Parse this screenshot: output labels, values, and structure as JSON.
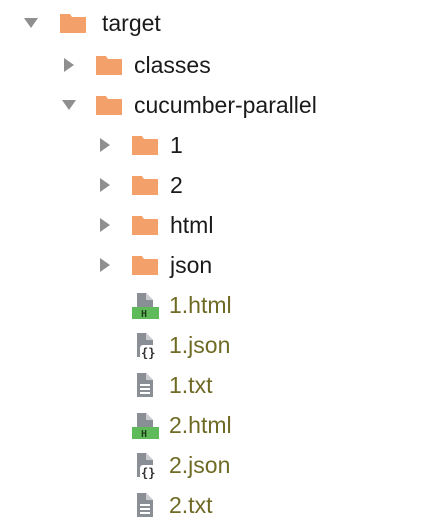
{
  "colors": {
    "folder": "#f4a06a",
    "arrow": "#8f8f8f",
    "file_text": "#6f6a24",
    "folder_text": "#1a1a1a",
    "html_badge": "#5fba5a",
    "doc_gray": "#8a8f96"
  },
  "tree": {
    "root": {
      "label": "target",
      "state": "expanded",
      "icon": "folder-icon"
    },
    "classes": {
      "label": "classes",
      "state": "collapsed",
      "icon": "folder-icon"
    },
    "cucumber": {
      "label": "cucumber-parallel",
      "state": "expanded",
      "icon": "folder-icon"
    },
    "children": [
      {
        "label": "1",
        "state": "collapsed",
        "icon": "folder-icon"
      },
      {
        "label": "2",
        "state": "collapsed",
        "icon": "folder-icon"
      },
      {
        "label": "html",
        "state": "collapsed",
        "icon": "folder-icon"
      },
      {
        "label": "json",
        "state": "collapsed",
        "icon": "folder-icon"
      },
      {
        "label": "1.html",
        "icon": "html-file-icon",
        "badge": "H"
      },
      {
        "label": "1.json",
        "icon": "json-file-icon",
        "badge": "{}"
      },
      {
        "label": "1.txt",
        "icon": "text-file-icon"
      },
      {
        "label": "2.html",
        "icon": "html-file-icon",
        "badge": "H"
      },
      {
        "label": "2.json",
        "icon": "json-file-icon",
        "badge": "{}"
      },
      {
        "label": "2.txt",
        "icon": "text-file-icon"
      }
    ]
  }
}
